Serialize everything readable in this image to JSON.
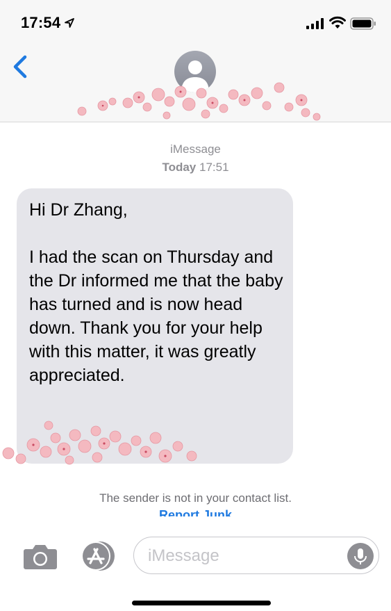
{
  "status_bar": {
    "time": "17:54"
  },
  "header": {
    "back_icon": "chevron-left-icon",
    "avatar_icon": "person-silhouette-icon"
  },
  "conversation": {
    "service": "iMessage",
    "date_day": "Today",
    "date_time": "17:51",
    "message": "Hi Dr Zhang,\n\nI had the scan on Thursday and the Dr informed me that the baby has turned and is now head down. Thank you for your help with this matter, it was greatly appreciated."
  },
  "sender_notice": {
    "text": "The sender is not in your contact list.",
    "report_link": "Report Junk"
  },
  "input_bar": {
    "placeholder": "iMessage"
  },
  "colors": {
    "accent": "#1f7ae0",
    "bubble": "#e5e5ea",
    "header_bg": "#f7f7f7",
    "flower_pink": "#f4b9c0"
  }
}
